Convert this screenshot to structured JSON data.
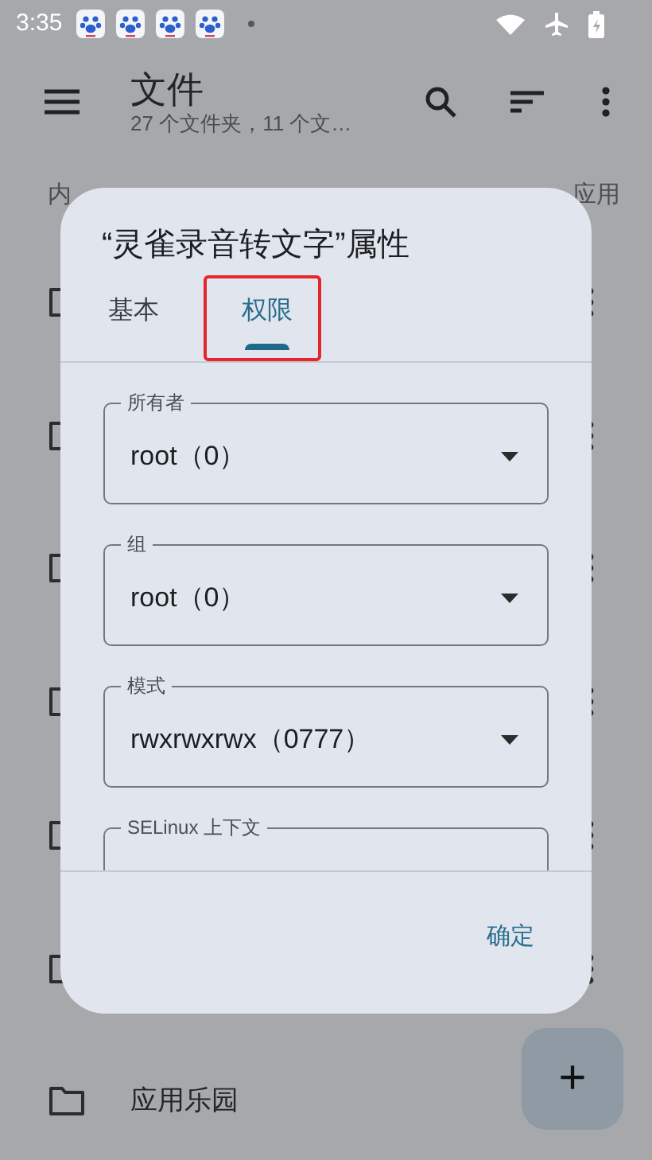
{
  "status_bar": {
    "time": "3:35"
  },
  "app_bar": {
    "title": "文件",
    "subtitle": "27 个文件夹，11 个文…"
  },
  "section_header": {
    "left": "内",
    "right": "应用"
  },
  "rows": [
    {
      "name": "应用乐园"
    }
  ],
  "fab": {
    "label": "+"
  },
  "dialog": {
    "title": "“灵雀录音转文字”属性",
    "tabs": [
      {
        "label": "基本",
        "selected": false,
        "highlighted": false
      },
      {
        "label": "权限",
        "selected": true,
        "highlighted": true
      }
    ],
    "fields": [
      {
        "label": "所有者",
        "value": "root（0）"
      },
      {
        "label": "组",
        "value": "root（0）"
      },
      {
        "label": "模式",
        "value": "rwxrwxrwx（0777）"
      },
      {
        "label": "SELinux 上下文"
      }
    ],
    "buttons": [
      "确定"
    ]
  }
}
